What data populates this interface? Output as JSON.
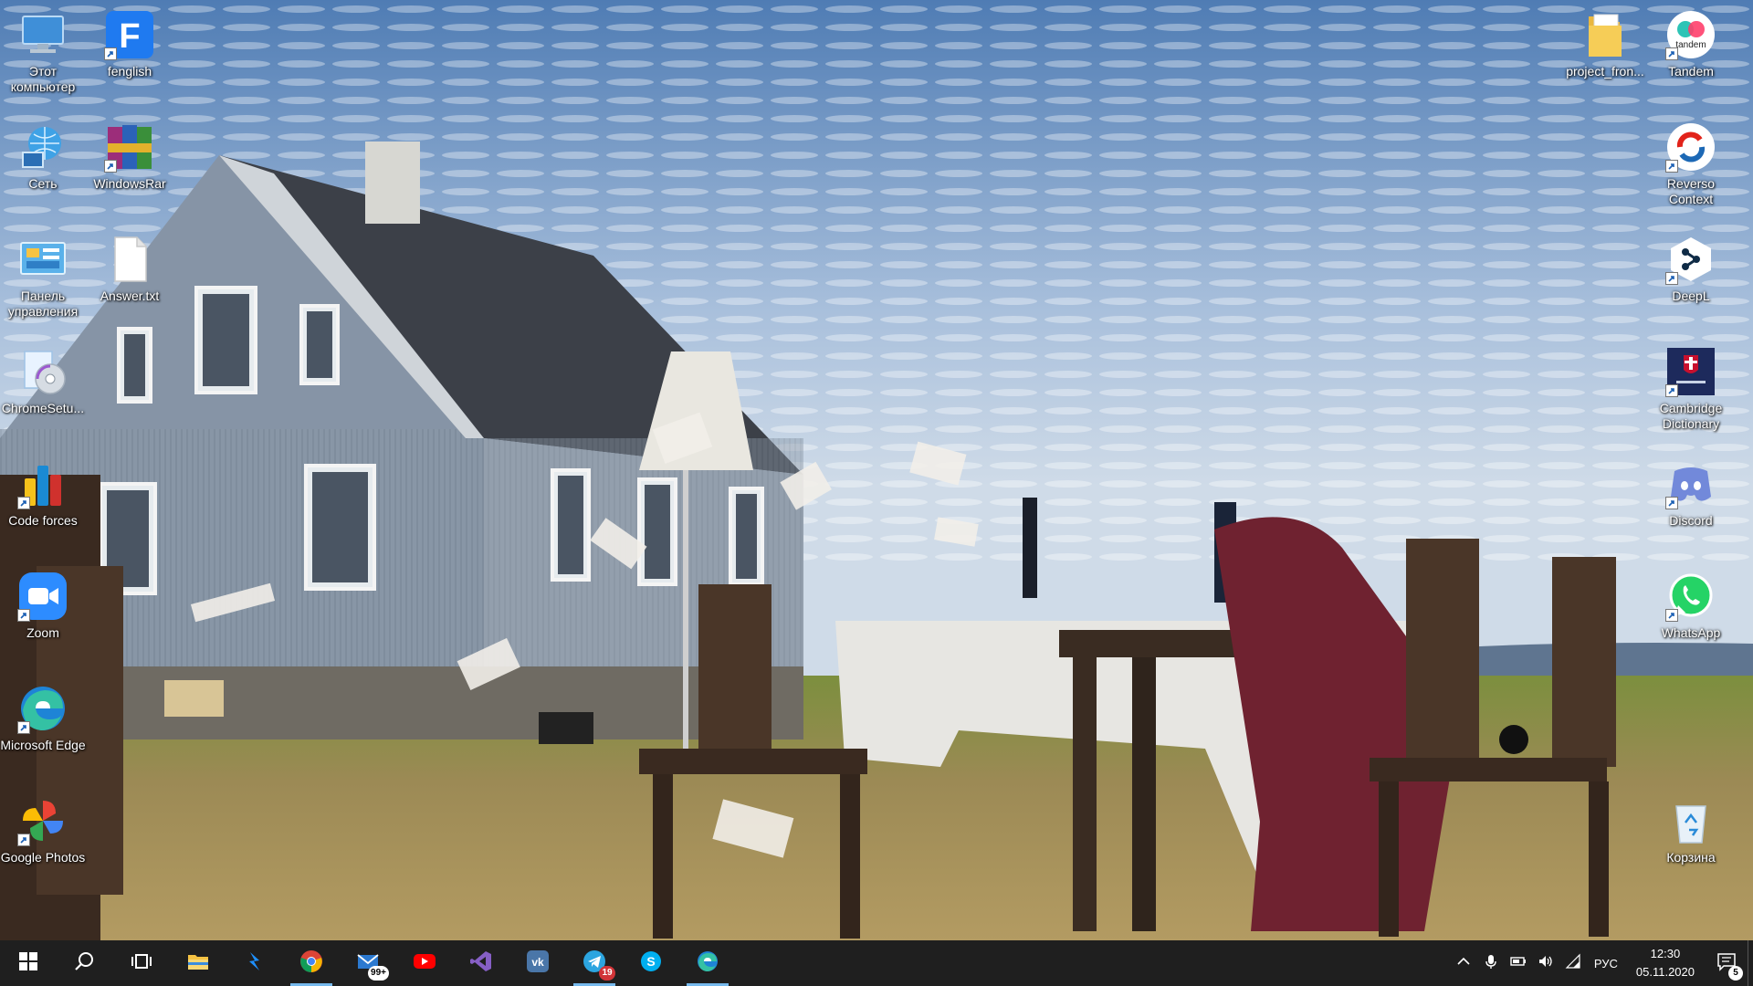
{
  "desktop": {
    "icons_left": [
      {
        "name": "this-pc",
        "label": "Этот компьютер",
        "icon": "computer-icon"
      },
      {
        "name": "fenglish",
        "label": "fenglish",
        "icon": "fenglish-app-icon",
        "shortcut": true
      },
      {
        "name": "network",
        "label": "Сеть",
        "icon": "network-globe-icon"
      },
      {
        "name": "winrar",
        "label": "WindowsRar",
        "icon": "winrar-books-icon",
        "shortcut": true
      },
      {
        "name": "control-panel",
        "label": "Панель управления",
        "icon": "control-panel-icon"
      },
      {
        "name": "answer-txt",
        "label": "Answer.txt",
        "icon": "text-file-icon"
      },
      {
        "name": "chrome-setup",
        "label": "ChromeSetu...",
        "icon": "installer-disc-icon"
      },
      {
        "name": "codeforces",
        "label": "Code forces",
        "icon": "codeforces-bars-icon",
        "shortcut": true
      },
      {
        "name": "zoom",
        "label": "Zoom",
        "icon": "zoom-camera-icon",
        "shortcut": true
      },
      {
        "name": "edge",
        "label": "Microsoft Edge",
        "icon": "edge-browser-icon",
        "shortcut": true
      },
      {
        "name": "google-photos",
        "label": "Google Photos",
        "icon": "google-photos-pinwheel-icon",
        "shortcut": true
      }
    ],
    "icons_right": [
      {
        "name": "project-front",
        "label": "project_fron...",
        "icon": "folder-icon"
      },
      {
        "name": "tandem",
        "label": "Tandem",
        "icon": "tandem-app-icon",
        "shortcut": true
      },
      {
        "name": "reverso",
        "label": "Reverso Context",
        "icon": "reverso-icon",
        "shortcut": true
      },
      {
        "name": "deepl",
        "label": "DeepL",
        "icon": "deepl-icon",
        "shortcut": true
      },
      {
        "name": "cambridge",
        "label": "Cambridge Dictionary",
        "icon": "cambridge-dictionary-icon",
        "shortcut": true
      },
      {
        "name": "discord",
        "label": "Discord",
        "icon": "discord-icon",
        "shortcut": true
      },
      {
        "name": "whatsapp",
        "label": "WhatsApp",
        "icon": "whatsapp-icon",
        "shortcut": true
      },
      {
        "name": "recycle-bin",
        "label": "Корзина",
        "icon": "recycle-bin-icon"
      }
    ]
  },
  "taskbar": {
    "apps": [
      {
        "name": "start",
        "icon": "windows-start-icon"
      },
      {
        "name": "search",
        "icon": "search-icon"
      },
      {
        "name": "task-view",
        "icon": "task-view-icon"
      },
      {
        "name": "file-explorer",
        "icon": "folder-icon"
      },
      {
        "name": "vscode-like",
        "icon": "bolt-app-icon"
      },
      {
        "name": "chrome",
        "icon": "chrome-icon",
        "active": true
      },
      {
        "name": "mail",
        "icon": "mail-icon",
        "badge": "99+"
      },
      {
        "name": "youtube",
        "icon": "youtube-icon"
      },
      {
        "name": "visual-studio",
        "icon": "visual-studio-icon"
      },
      {
        "name": "vk",
        "icon": "vk-icon"
      },
      {
        "name": "telegram",
        "icon": "telegram-icon",
        "badge": "19",
        "active": true
      },
      {
        "name": "skype",
        "icon": "skype-icon"
      },
      {
        "name": "edge",
        "icon": "edge-browser-icon",
        "active": true
      }
    ],
    "tray": {
      "language": "РУС",
      "time": "12:30",
      "date": "05.11.2020",
      "notifications": "5"
    }
  },
  "colors": {
    "taskbar": "#1f1f1f",
    "accent": "#76b9ed",
    "badge": "#d13438"
  }
}
